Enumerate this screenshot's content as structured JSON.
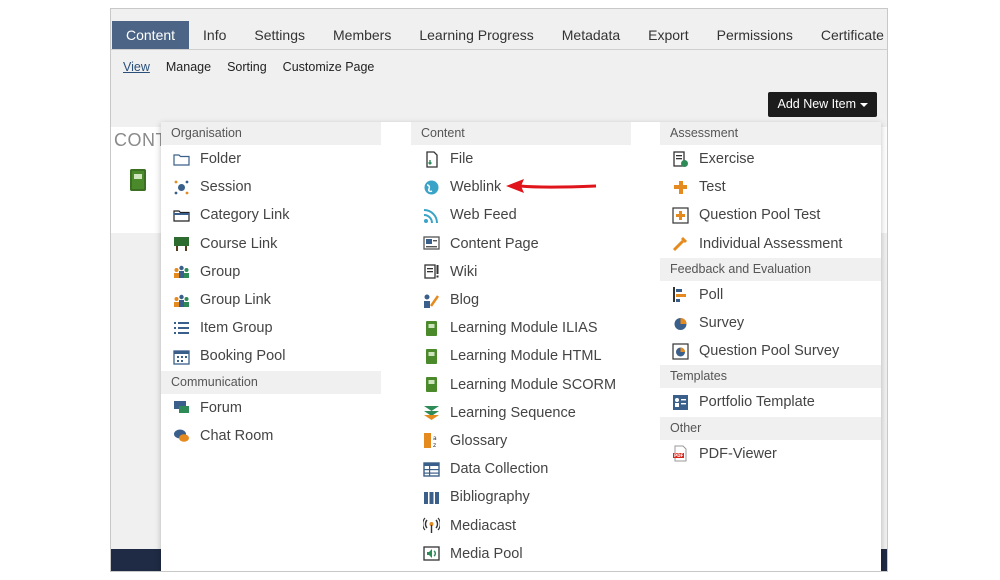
{
  "tabs": [
    "Content",
    "Info",
    "Settings",
    "Members",
    "Learning Progress",
    "Metadata",
    "Export",
    "Permissions",
    "Certificate"
  ],
  "active_tab": "Content",
  "subtabs": [
    "View",
    "Manage",
    "Sorting",
    "Customize Page"
  ],
  "active_subtab": "View",
  "add_button": "Add New Item",
  "background_title": "CONT",
  "menu": {
    "col1": [
      {
        "heading": "Organisation",
        "items": [
          {
            "label": "Folder",
            "icon": "folder-icon"
          },
          {
            "label": "Session",
            "icon": "session-icon"
          },
          {
            "label": "Category Link",
            "icon": "category-link-icon"
          },
          {
            "label": "Course Link",
            "icon": "course-link-icon"
          },
          {
            "label": "Group",
            "icon": "group-icon"
          },
          {
            "label": "Group Link",
            "icon": "group-link-icon"
          },
          {
            "label": "Item Group",
            "icon": "item-group-icon"
          },
          {
            "label": "Booking Pool",
            "icon": "booking-pool-icon"
          }
        ]
      },
      {
        "heading": "Communication",
        "items": [
          {
            "label": "Forum",
            "icon": "forum-icon"
          },
          {
            "label": "Chat Room",
            "icon": "chat-room-icon"
          }
        ]
      }
    ],
    "col2": [
      {
        "heading": "Content",
        "items": [
          {
            "label": "File",
            "icon": "file-icon"
          },
          {
            "label": "Weblink",
            "icon": "weblink-icon"
          },
          {
            "label": "Web Feed",
            "icon": "web-feed-icon"
          },
          {
            "label": "Content Page",
            "icon": "content-page-icon"
          },
          {
            "label": "Wiki",
            "icon": "wiki-icon"
          },
          {
            "label": "Blog",
            "icon": "blog-icon"
          },
          {
            "label": "Learning Module ILIAS",
            "icon": "learning-module-icon"
          },
          {
            "label": "Learning Module HTML",
            "icon": "learning-module-icon"
          },
          {
            "label": "Learning Module SCORM",
            "icon": "learning-module-icon"
          },
          {
            "label": "Learning Sequence",
            "icon": "learning-sequence-icon"
          },
          {
            "label": "Glossary",
            "icon": "glossary-icon"
          },
          {
            "label": "Data Collection",
            "icon": "data-collection-icon"
          },
          {
            "label": "Bibliography",
            "icon": "bibliography-icon"
          },
          {
            "label": "Mediacast",
            "icon": "mediacast-icon"
          },
          {
            "label": "Media Pool",
            "icon": "media-pool-icon"
          }
        ]
      }
    ],
    "col3": [
      {
        "heading": "Assessment",
        "items": [
          {
            "label": "Exercise",
            "icon": "exercise-icon"
          },
          {
            "label": "Test",
            "icon": "test-icon"
          },
          {
            "label": "Question Pool Test",
            "icon": "question-pool-test-icon"
          },
          {
            "label": "Individual Assessment",
            "icon": "individual-assessment-icon"
          }
        ]
      },
      {
        "heading": "Feedback and Evaluation",
        "items": [
          {
            "label": "Poll",
            "icon": "poll-icon"
          },
          {
            "label": "Survey",
            "icon": "survey-icon"
          },
          {
            "label": "Question Pool Survey",
            "icon": "question-pool-survey-icon"
          }
        ]
      },
      {
        "heading": "Templates",
        "items": [
          {
            "label": "Portfolio Template",
            "icon": "portfolio-template-icon"
          }
        ]
      },
      {
        "heading": "Other",
        "items": [
          {
            "label": "PDF-Viewer",
            "icon": "pdf-viewer-icon"
          }
        ]
      }
    ]
  },
  "colors": {
    "active_tab_bg": "#4c6586",
    "button_bg": "#1c1c1c",
    "arrow": "#e0141b"
  }
}
